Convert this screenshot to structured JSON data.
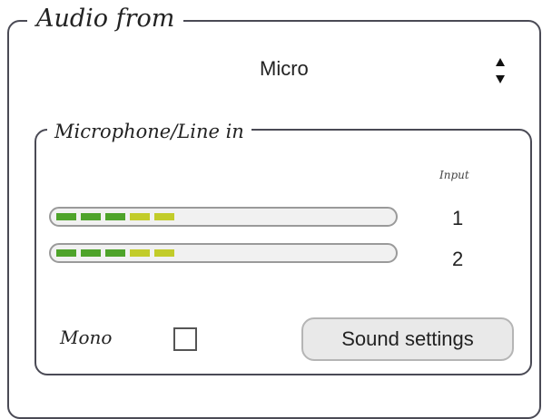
{
  "audio_from": {
    "title": "Audio from",
    "source": {
      "selected": "Micro",
      "control_icon": "up-down-arrows-icon"
    }
  },
  "microphone_group": {
    "title": "Microphone/Line in",
    "input_header": "Input",
    "channels": [
      {
        "label": "1",
        "level_segments": [
          "green",
          "green",
          "green",
          "yellow",
          "yellow"
        ]
      },
      {
        "label": "2",
        "level_segments": [
          "green",
          "green",
          "green",
          "yellow",
          "yellow"
        ]
      }
    ],
    "colors": {
      "green": "#4ea32a",
      "yellow": "#c2cc2a"
    }
  },
  "mono": {
    "label": "Mono",
    "checked": false
  },
  "sound_settings": {
    "label": "Sound settings"
  }
}
